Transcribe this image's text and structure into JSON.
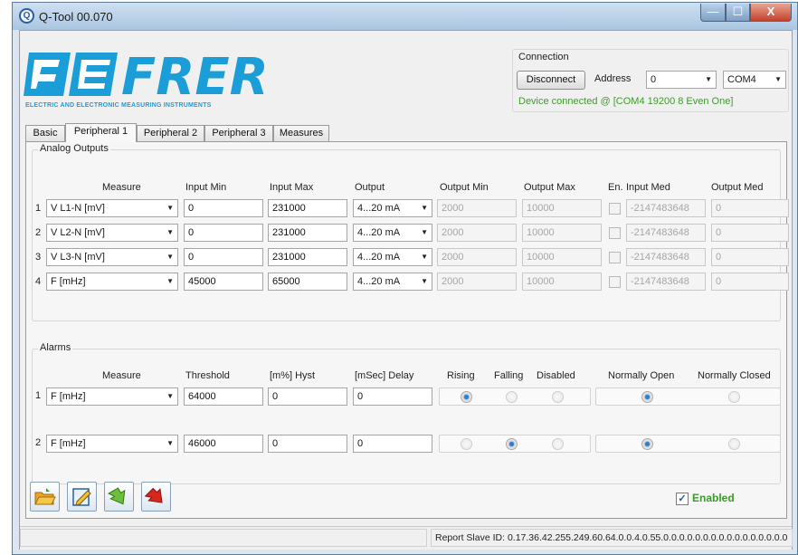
{
  "window": {
    "title": "Q-Tool 00.070",
    "controls": {
      "minimize": "—",
      "maximize": "☐",
      "close": "X"
    }
  },
  "logo": {
    "brand": "FRER",
    "tagline": "ELECTRIC AND ELECTRONIC MEASURING INSTRUMENTS",
    "accent": "#1b9ed8"
  },
  "connection": {
    "legend": "Connection",
    "disconnect_label": "Disconnect",
    "address_label": "Address",
    "address_value": "0",
    "port_value": "COM4",
    "status_text": "Device connected @ [COM4 19200 8 Even One]",
    "status_color": "#3d9b2a"
  },
  "tabs": [
    {
      "label": "Basic",
      "active": false
    },
    {
      "label": "Peripheral 1",
      "active": true
    },
    {
      "label": "Peripheral 2",
      "active": false
    },
    {
      "label": "Peripheral 3",
      "active": false
    },
    {
      "label": "Measures",
      "active": false
    }
  ],
  "analog": {
    "legend": "Analog Outputs",
    "headers": {
      "measure": "Measure",
      "input_min": "Input Min",
      "input_max": "Input Max",
      "output": "Output",
      "output_min": "Output Min",
      "output_max": "Output Max",
      "enabled": "En.",
      "input_med": "Input Med",
      "output_med": "Output Med"
    },
    "rows": [
      {
        "num": "1",
        "measure": "V L1-N [mV]",
        "input_min": "0",
        "input_max": "231000",
        "output": "4...20 mA",
        "output_min": "2000",
        "output_max": "10000",
        "enabled": false,
        "input_med": "-2147483648",
        "output_med": "0"
      },
      {
        "num": "2",
        "measure": "V L2-N [mV]",
        "input_min": "0",
        "input_max": "231000",
        "output": "4...20 mA",
        "output_min": "2000",
        "output_max": "10000",
        "enabled": false,
        "input_med": "-2147483648",
        "output_med": "0"
      },
      {
        "num": "3",
        "measure": "V L3-N [mV]",
        "input_min": "0",
        "input_max": "231000",
        "output": "4...20 mA",
        "output_min": "2000",
        "output_max": "10000",
        "enabled": false,
        "input_med": "-2147483648",
        "output_med": "0"
      },
      {
        "num": "4",
        "measure": "F [mHz]",
        "input_min": "45000",
        "input_max": "65000",
        "output": "4...20 mA",
        "output_min": "2000",
        "output_max": "10000",
        "enabled": false,
        "input_med": "-2147483648",
        "output_med": "0"
      }
    ]
  },
  "alarms": {
    "legend": "Alarms",
    "headers": {
      "measure": "Measure",
      "threshold": "Threshold",
      "hyst": "[m%] Hyst",
      "delay": "[mSec] Delay",
      "rising": "Rising",
      "falling": "Falling",
      "disabled": "Disabled",
      "normally_open": "Normally Open",
      "normally_closed": "Normally Closed"
    },
    "rows": [
      {
        "num": "1",
        "measure": "F [mHz]",
        "threshold": "64000",
        "hyst": "0",
        "delay": "0",
        "edge": "rising",
        "contact": "normally_open"
      },
      {
        "num": "2",
        "measure": "F [mHz]",
        "threshold": "46000",
        "hyst": "0",
        "delay": "0",
        "edge": "falling",
        "contact": "normally_open"
      }
    ]
  },
  "toolbar": {
    "icons": [
      "open-folder-icon",
      "edit-icon",
      "download-arrow-icon",
      "upload-arrow-icon"
    ]
  },
  "enabled": {
    "label": "Enabled",
    "checked": true,
    "mark": "✓"
  },
  "status_bar": {
    "report": "Report Slave ID: 0.17.36.42.255.249.60.64.0.0.4.0.55.0.0.0.0.0.0.0.0.0.0.0.0.0.0.0.0"
  }
}
